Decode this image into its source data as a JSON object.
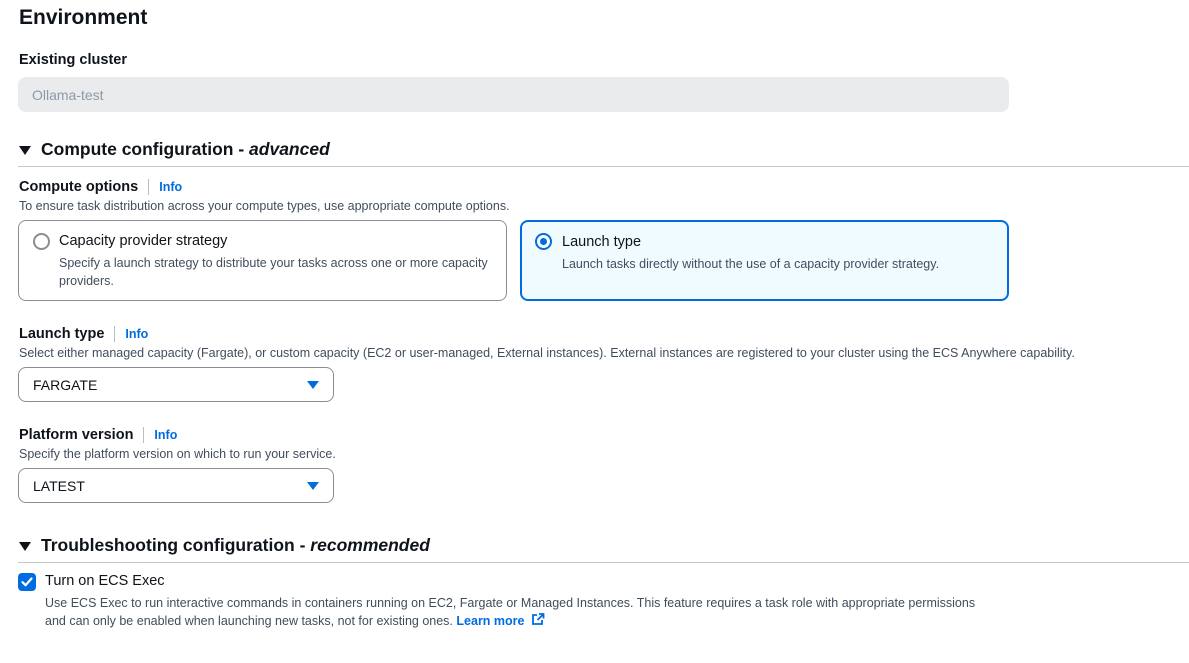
{
  "environment": {
    "title": "Environment",
    "existing_cluster_label": "Existing cluster",
    "existing_cluster_value": "Ollama-test"
  },
  "compute_section": {
    "title": "Compute configuration",
    "title_suffix": "advanced",
    "dash": " - "
  },
  "compute_options": {
    "label": "Compute options",
    "info": "Info",
    "description": "To ensure task distribution across your compute types, use appropriate compute options.",
    "tiles": [
      {
        "title": "Capacity provider strategy",
        "description": "Specify a launch strategy to distribute your tasks across one or more capacity providers.",
        "selected": false
      },
      {
        "title": "Launch type",
        "description": "Launch tasks directly without the use of a capacity provider strategy.",
        "selected": true
      }
    ]
  },
  "launch_type": {
    "label": "Launch type",
    "info": "Info",
    "description": "Select either managed capacity (Fargate), or custom capacity (EC2 or user-managed, External instances). External instances are registered to your cluster using the ECS Anywhere capability.",
    "value": "FARGATE"
  },
  "platform_version": {
    "label": "Platform version",
    "info": "Info",
    "description": "Specify the platform version on which to run your service.",
    "value": "LATEST"
  },
  "troubleshooting_section": {
    "title": "Troubleshooting configuration",
    "title_suffix": "recommended",
    "dash": " - "
  },
  "ecs_exec": {
    "label": "Turn on ECS Exec",
    "checked": true,
    "description": "Use ECS Exec to run interactive commands in containers running on EC2, Fargate or Managed Instances. This feature requires a task role with appropriate permissions and can only be enabled when launching new tasks, not for existing ones.",
    "link": "Learn more"
  },
  "colors": {
    "accent": "#006ce0",
    "text": "#0f141a",
    "muted": "#414d5c",
    "selected_bg": "#f0fbff"
  }
}
